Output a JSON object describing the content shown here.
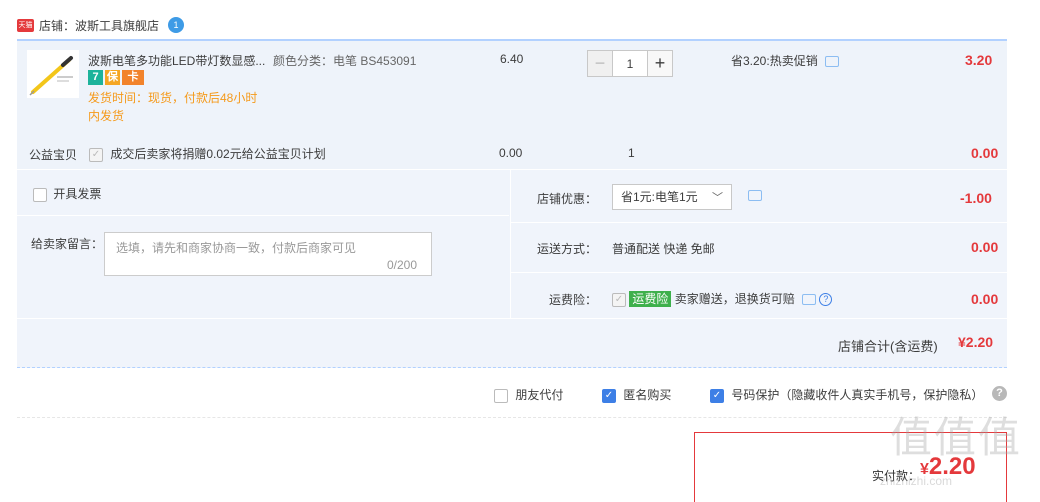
{
  "shop": {
    "badge": "天猫",
    "label": "店铺：波斯工具旗舰店",
    "ww": "1"
  },
  "item": {
    "title": "波斯电笔多功能LED带灯数显感...",
    "sku": "颜色分类：电笔 BS453091",
    "ship_line1": "发货时间：现货，付款后48小时",
    "ship_line2": "内发货",
    "tags": [
      "7",
      "保",
      "卡"
    ],
    "unit_price": "6.40",
    "qty": "1",
    "minus": "−",
    "plus": "+",
    "promo": "省3.20:热卖促销",
    "subtotal": "3.20"
  },
  "charity": {
    "label": "公益宝贝",
    "text": "成交后卖家将捐赠0.02元给公益宝贝计划",
    "price": "0.00",
    "qty": "1",
    "subtotal": "0.00"
  },
  "invoice": {
    "label": "开具发票"
  },
  "message": {
    "label": "给卖家留言：",
    "placeholder": "选填，请先和商家协商一致，付款后商家可见",
    "count": "0/200"
  },
  "discount": {
    "label": "店铺优惠：",
    "selected": "省1元:电笔1元",
    "amount": "-1.00"
  },
  "shipping": {
    "label": "运送方式：",
    "value": "普通配送 快递 免邮",
    "amount": "0.00"
  },
  "insurance": {
    "label": "运费险：",
    "badge": "运费险",
    "text": "卖家赠送，退换货可赔",
    "amount": "0.00"
  },
  "total": {
    "label": "店铺合计(含运费)",
    "value": "¥2.20"
  },
  "footer_options": [
    {
      "label": "朋友代付",
      "checked": false
    },
    {
      "label": "匿名购买",
      "checked": true
    },
    {
      "label": "号码保护（隐藏收件人真实手机号，保护隐私）",
      "checked": true
    }
  ],
  "payment": {
    "label": "实付款：",
    "currency": "¥",
    "amount": "2.20"
  },
  "watermark": {
    "glyphs": "值值值",
    "site": "zhizhizhi.com"
  },
  "colors": {
    "accent_red": "#e4393c",
    "blue_check": "#3d7fe6",
    "ship_orange": "#f59a1b"
  }
}
